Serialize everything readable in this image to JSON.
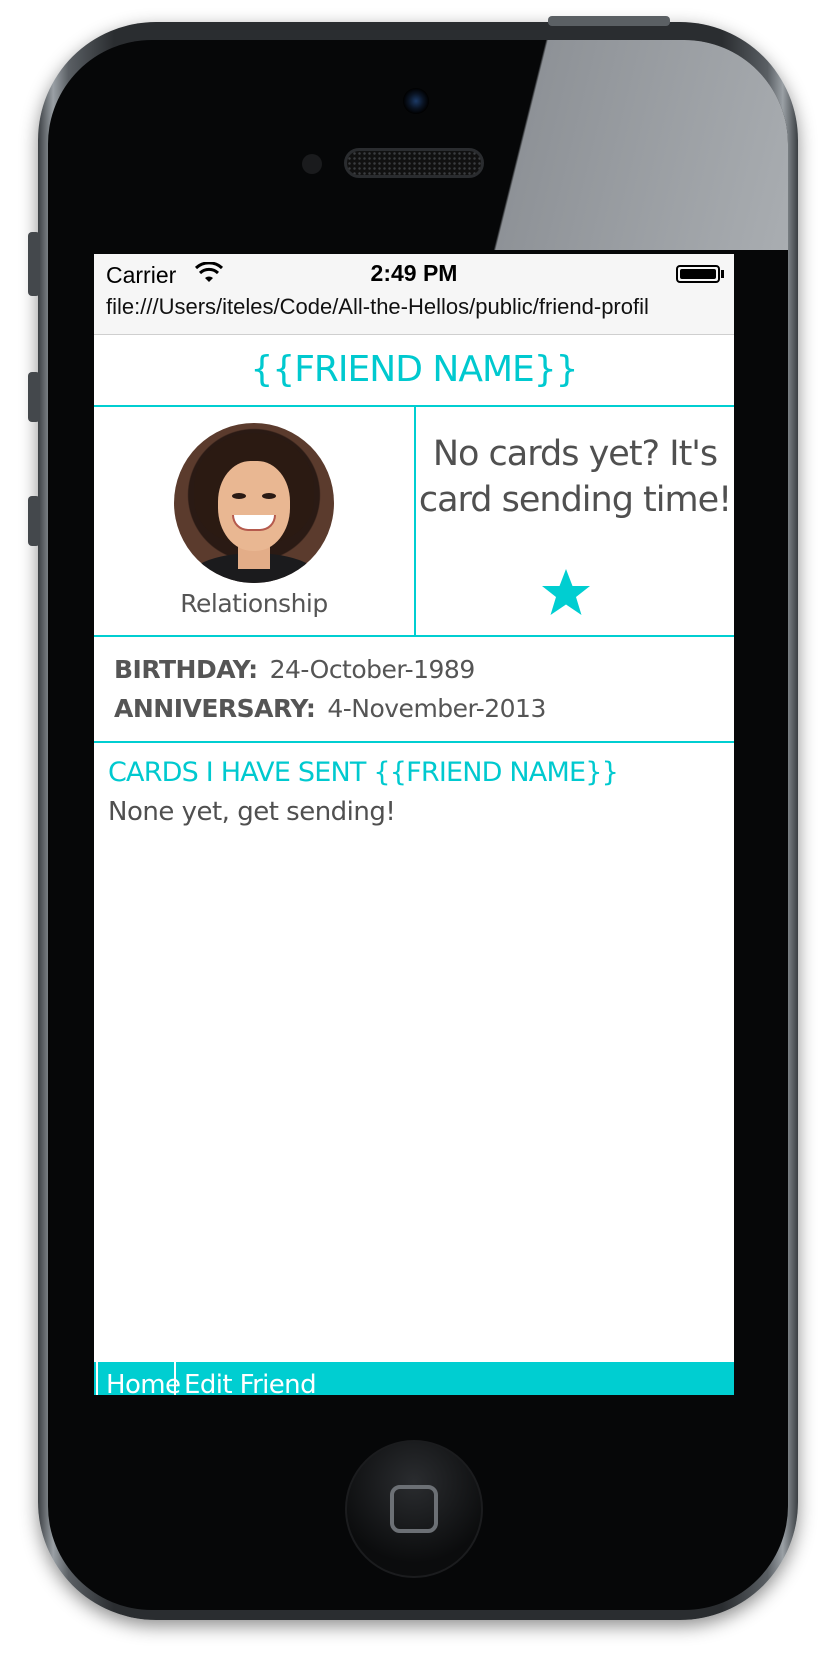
{
  "statusbar": {
    "carrier": "Carrier",
    "time": "2:49 PM",
    "url": "file:///Users/iteles/Code/All-the-Hellos/public/friend-profil"
  },
  "profile": {
    "title": "{{FRIEND NAME}}",
    "relationship": "Relationship",
    "no_cards_message": "No cards yet? It's card sending time!",
    "star_icon": "star-icon"
  },
  "dates": {
    "birthday_label": "BIRTHDAY:",
    "birthday_value": "24-October-1989",
    "anniversary_label": "ANNIVERSARY:",
    "anniversary_value": "4-November-2013"
  },
  "cards": {
    "heading": "CARDS I HAVE SENT {{FRIEND NAME}}",
    "empty_message": "None yet, get sending!"
  },
  "nav": {
    "home": "Home",
    "edit_friend": "Edit Friend"
  },
  "colors": {
    "accent": "#00ced1",
    "text": "#505050"
  }
}
